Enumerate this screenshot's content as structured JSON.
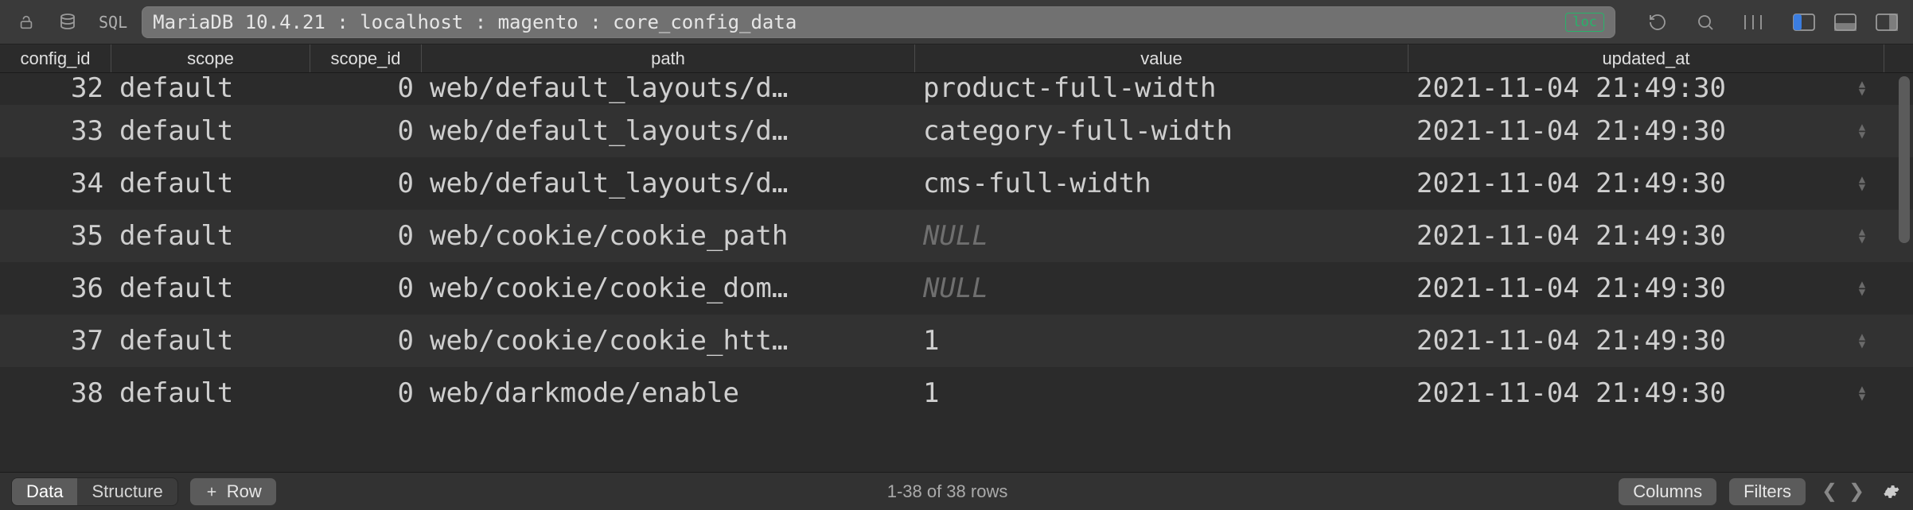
{
  "toolbar": {
    "sql_label": "SQL",
    "breadcrumb": "MariaDB 10.4.21 : localhost : magento : core_config_data",
    "loc_badge": "loc"
  },
  "columns": [
    "config_id",
    "scope",
    "scope_id",
    "path",
    "value",
    "updated_at"
  ],
  "rows": [
    {
      "config_id": 32,
      "scope": "default",
      "scope_id": 0,
      "path": "web/default_layouts/d…",
      "value": "product-full-width",
      "value_is_null": false,
      "updated_at": "2021-11-04 21:49:30"
    },
    {
      "config_id": 33,
      "scope": "default",
      "scope_id": 0,
      "path": "web/default_layouts/d…",
      "value": "category-full-width",
      "value_is_null": false,
      "updated_at": "2021-11-04 21:49:30"
    },
    {
      "config_id": 34,
      "scope": "default",
      "scope_id": 0,
      "path": "web/default_layouts/d…",
      "value": "cms-full-width",
      "value_is_null": false,
      "updated_at": "2021-11-04 21:49:30"
    },
    {
      "config_id": 35,
      "scope": "default",
      "scope_id": 0,
      "path": "web/cookie/cookie_path",
      "value": "NULL",
      "value_is_null": true,
      "updated_at": "2021-11-04 21:49:30"
    },
    {
      "config_id": 36,
      "scope": "default",
      "scope_id": 0,
      "path": "web/cookie/cookie_dom…",
      "value": "NULL",
      "value_is_null": true,
      "updated_at": "2021-11-04 21:49:30"
    },
    {
      "config_id": 37,
      "scope": "default",
      "scope_id": 0,
      "path": "web/cookie/cookie_htt…",
      "value": "1",
      "value_is_null": false,
      "updated_at": "2021-11-04 21:49:30"
    },
    {
      "config_id": 38,
      "scope": "default",
      "scope_id": 0,
      "path": "web/darkmode/enable",
      "value": "1",
      "value_is_null": false,
      "updated_at": "2021-11-04 21:49:30"
    }
  ],
  "footer": {
    "tabs": {
      "data": "Data",
      "structure": "Structure",
      "active": "data"
    },
    "add_row_label": "Row",
    "status": "1-38 of 38 rows",
    "columns_btn": "Columns",
    "filters_btn": "Filters"
  }
}
